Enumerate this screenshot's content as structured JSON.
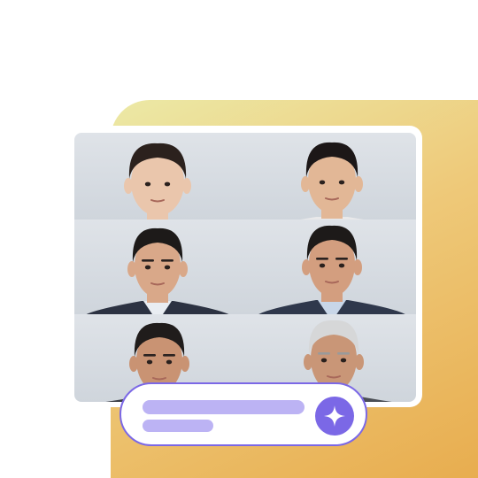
{
  "photos": [
    {
      "label": "baby-portrait",
      "hair": "#2b211d",
      "skin": "#eac6ac",
      "clothing": "#ffffff",
      "shirt": "#ffffff"
    },
    {
      "label": "child-portrait",
      "hair": "#1c1717",
      "skin": "#e2b796",
      "clothing": "#e9e9ea",
      "shirt": "#e9e9ea"
    },
    {
      "label": "young-adult-portrait",
      "hair": "#1d1a19",
      "skin": "#d9a889",
      "clothing": "#2c3242",
      "shirt": "#e9edf2"
    },
    {
      "label": "adult-portrait",
      "hair": "#1d1a19",
      "skin": "#d39e7f",
      "clothing": "#2f384c",
      "shirt": "#c8d6e8"
    },
    {
      "label": "middle-age-portrait",
      "hair": "#201c1b",
      "skin": "#c99373",
      "clothing": "#3a3d45",
      "shirt": "#dfe3ea"
    },
    {
      "label": "elderly-portrait",
      "hair": "#d6d7d8",
      "skin": "#c99677",
      "clothing": "#4a4e55",
      "shirt": "#e6e6e6"
    }
  ],
  "prompt_bar": {
    "icon": "sparkle-icon"
  },
  "colors": {
    "accent": "#7b68e6",
    "placeholder": "#bcb3f4",
    "background_gradient": [
      "#ece9a6",
      "#e8ad4f"
    ]
  }
}
